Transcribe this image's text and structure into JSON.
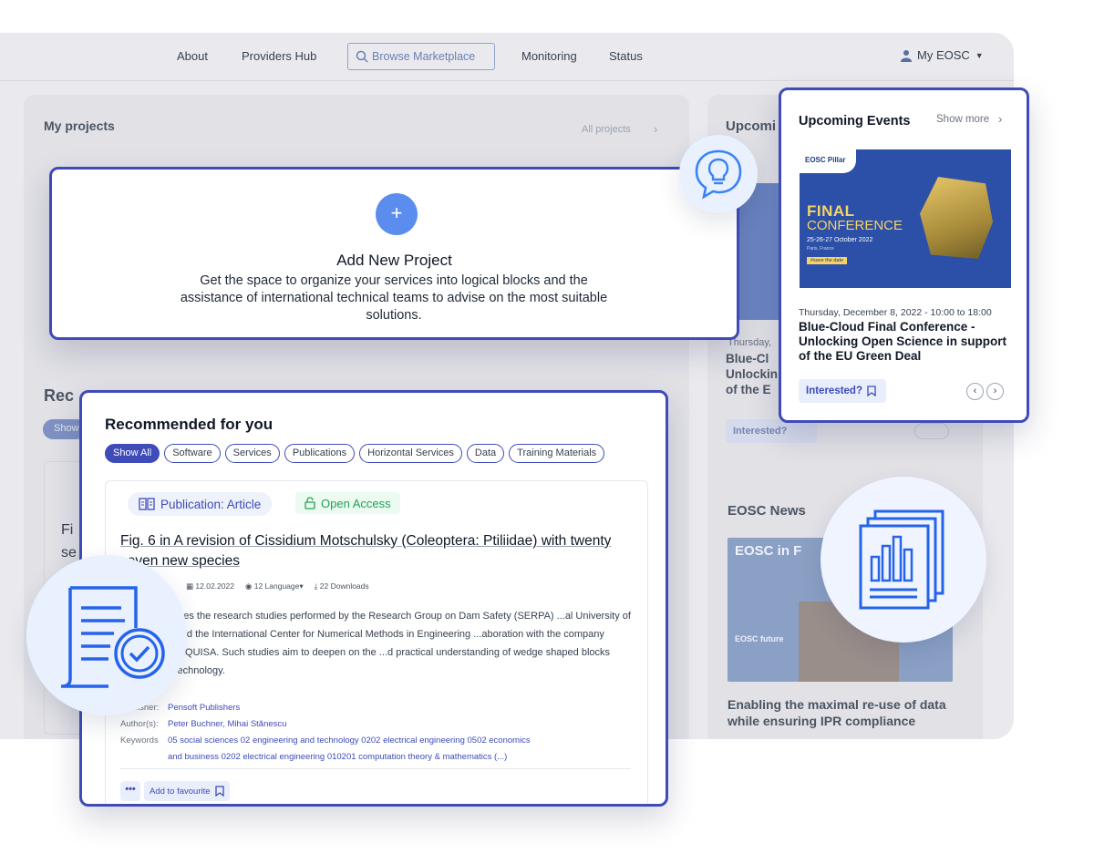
{
  "nav": {
    "about": "About",
    "providers_hub": "Providers Hub",
    "browse_marketplace": "Browse Marketplace",
    "monitoring": "Monitoring",
    "status": "Status",
    "my_eosc": "My EOSC"
  },
  "background": {
    "my_projects": "My projects",
    "all_projects": "All projects",
    "upcoming": "Upcomi",
    "recommended_partial": "Rec",
    "show_partial": "Show",
    "partial_fi": "Fi",
    "partial_se": "se",
    "bg_thursday": "Thursday, ",
    "bg_event_partial": "Blue-Cl",
    "bg_event_partial2": "Unlockin",
    "bg_event_partial3": "of the E",
    "bg_interested": "Interested?",
    "eosc_news": "EOSC News",
    "news_banner": "EOSC in F",
    "news_banner_sub": "EOSC future",
    "news_title": "Enabling the maximal re-use of data while ensuring IPR compliance"
  },
  "add_project": {
    "plus": "+",
    "title": "Add New Project",
    "description": "Get the space to organize your services into logical blocks and the assistance of international technical teams to advise on the most suitable solutions."
  },
  "events": {
    "title": "Upcoming Events",
    "show_more": "Show more",
    "banner": {
      "logo": "EOSC Pillar",
      "final": "FINAL",
      "conference": "CONFERENCE",
      "dates": "25-26-27 October 2022",
      "place": "Paris, France",
      "save": "#save the date"
    },
    "date": "Thursday, December 8, 2022 - 10:00 to 18:00",
    "name": "Blue-Cloud Final Conference - Unlocking Open Science in support of the EU Green Deal",
    "interested": "Interested?"
  },
  "recommended": {
    "title": "Recommended for you",
    "filters": [
      "Show All",
      "Software",
      "Services",
      "Publications",
      "Horizontal Services",
      "Data",
      "Training Materials"
    ],
    "item": {
      "type": "Publication: Article",
      "access": "Open Access",
      "title": "Fig. 6 in A revision of Cissidium Motschulsky (Coleoptera: Ptiliidae) with twenty seven new species",
      "date": "12.02.2022",
      "languages": "12 Language▾",
      "downloads": "22 Downloads",
      "abstract": "...mmarizes the research studies performed by the Research Group on Dam Safety (SERPA) ...al University of Madrid and the International Center for Numerical Methods in Engineering ...aboration with the company PREHORQUISA. Such studies aim to deepen on the ...d practical understanding of wedge shaped blocks (WSB) technology.",
      "publisher_label": "Publisher:",
      "publisher": "Pensoft Publishers",
      "authors_label": "Author(s):",
      "authors": "Peter Buchner, Mihai Stănescu",
      "keywords_label": "Keywords",
      "keywords_line1": "05 social sciences  02 engineering and technology  0202 electrical engineering  0502 economics",
      "keywords_line2": "and business  0202 electrical engineering  010201 computation theory & mathematics (...)",
      "more": "•••",
      "favourite": "Add to favourite"
    }
  },
  "colors": {
    "accent": "#3e4bb8",
    "primary_blue": "#5b8def",
    "open_access_green": "#22a05a",
    "circle_bg": "#eaf1fe"
  },
  "icons": [
    "lightbulb-chat-icon",
    "document-check-icon",
    "report-chart-icon",
    "search-icon",
    "user-icon",
    "bookmark-icon",
    "book-icon",
    "lock-open-icon",
    "calendar-icon",
    "globe-icon",
    "download-icon"
  ]
}
